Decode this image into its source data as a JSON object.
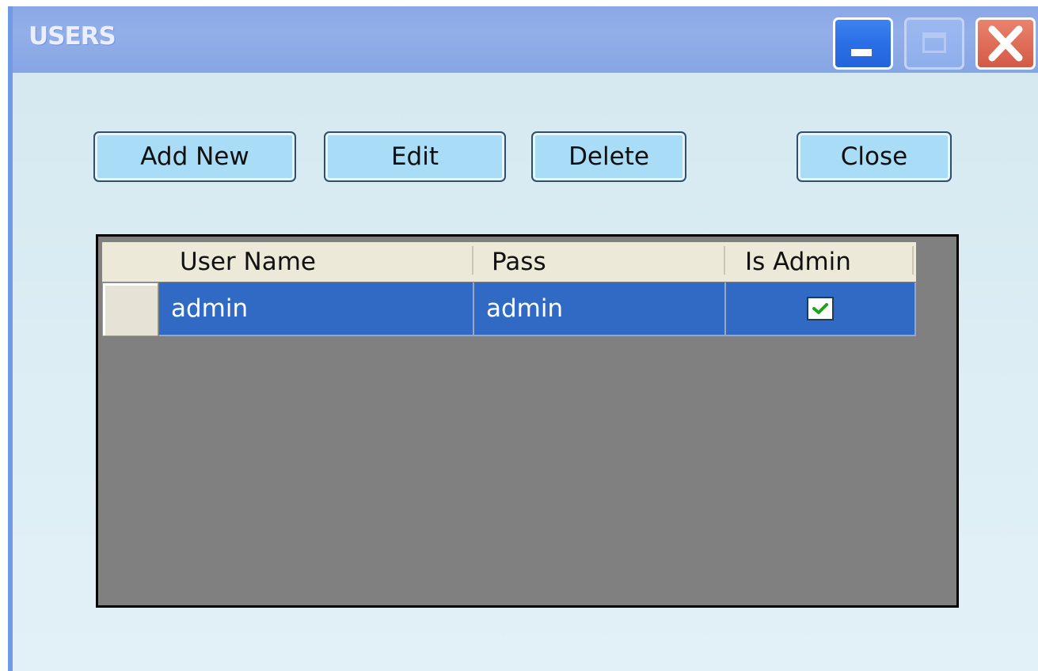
{
  "window": {
    "title": "USERS",
    "controls": [
      "minimize-icon",
      "maximize-icon",
      "close-icon"
    ]
  },
  "toolbar": {
    "add_new_label": "Add New",
    "edit_label": "Edit",
    "delete_label": "Delete",
    "close_label": "Close"
  },
  "grid": {
    "columns": [
      "User Name",
      "Pass",
      "Is Admin"
    ],
    "rows": [
      {
        "user_name": "admin",
        "pass": "admin",
        "is_admin": true
      }
    ],
    "selected_row": 0
  },
  "colors": {
    "selection": "#316ac5",
    "grid_background": "#808080",
    "header_background": "#ece9d8",
    "button_fill": "#a9dcf6",
    "checkmark": "#21a121"
  }
}
